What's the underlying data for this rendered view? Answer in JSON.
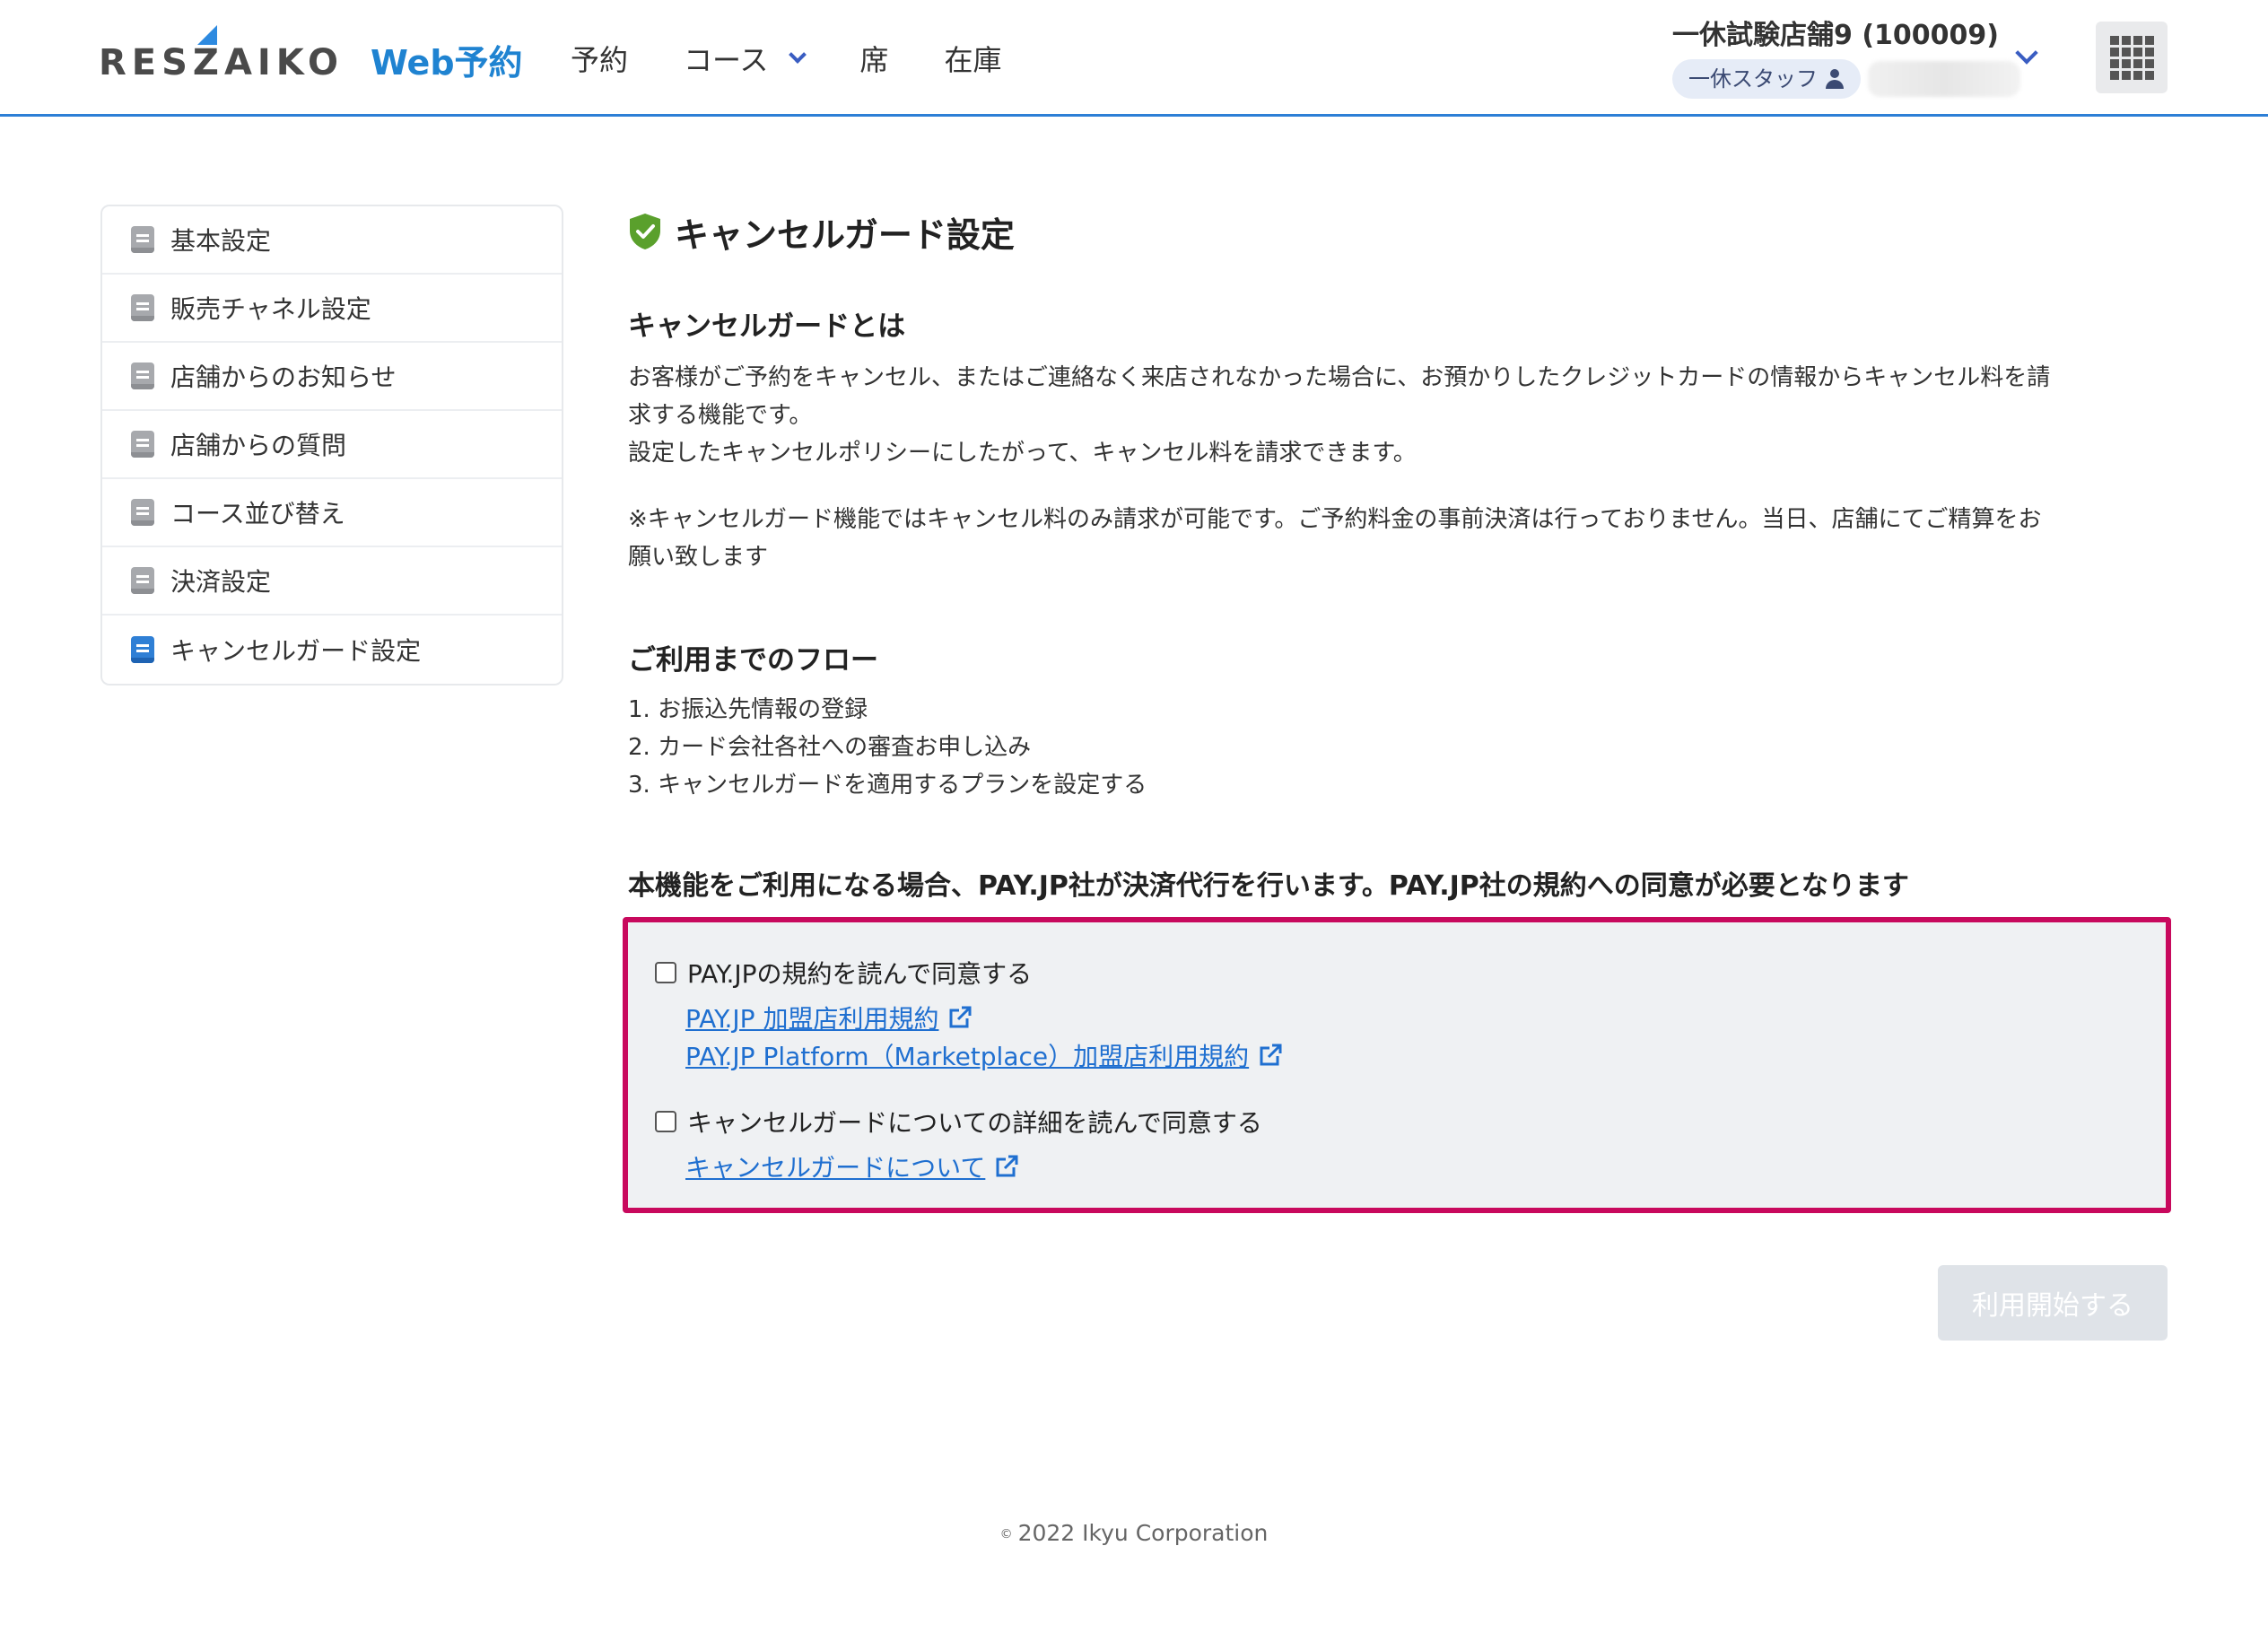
{
  "header": {
    "logo_text": "RESZAIKO",
    "logo_sub": "Web予約",
    "nav": [
      {
        "label": "予約"
      },
      {
        "label": "コース"
      },
      {
        "label": "席"
      },
      {
        "label": "在庫"
      }
    ],
    "store_name": "一休試験店舗9 (100009)",
    "staff_label": "一休スタッフ"
  },
  "sidebar": {
    "items": [
      {
        "label": "基本設定",
        "active": false
      },
      {
        "label": "販売チャネル設定",
        "active": false
      },
      {
        "label": "店舗からのお知らせ",
        "active": false
      },
      {
        "label": "店舗からの質問",
        "active": false
      },
      {
        "label": "コース並び替え",
        "active": false
      },
      {
        "label": "決済設定",
        "active": false
      },
      {
        "label": "キャンセルガード設定",
        "active": true
      }
    ]
  },
  "main": {
    "title": "キャンセルガード設定",
    "about_title": "キャンセルガードとは",
    "about_line1": "お客様がご予約をキャンセル、またはご連絡なく来店されなかった場合に、お預かりしたクレジットカードの情報からキャンセル料を請",
    "about_line2": "求する機能です。",
    "about_line3": "設定したキャンセルポリシーにしたがって、キャンセル料を請求できます。",
    "note_line1": "※キャンセルガード機能ではキャンセル料のみ請求が可能です。ご予約料金の事前決済は行っておりません。当日、店舗にてご精算をお",
    "note_line2": "願い致します",
    "flow_title": "ご利用までのフロー",
    "flow_steps": [
      "1. お振込先情報の登録",
      "2. カード会社各社への審査お申し込み",
      "3. キャンセルガードを適用するプランを設定する"
    ],
    "payjp_notice": "本機能をご利用になる場合、PAY.JP社が決済代行を行います。PAY.JP社の規約への同意が必要となります"
  },
  "agreement": {
    "payjp_checkbox_label": "PAY.JPの規約を読んで同意する",
    "payjp_checked": false,
    "link_merchant_terms": "PAY.JP 加盟店利用規約",
    "link_platform_terms": "PAY.JP Platform（Marketplace）加盟店利用規約",
    "cancelguard_checkbox_label": "キャンセルガードについての詳細を読んで同意する",
    "cancelguard_checked": false,
    "link_cancelguard": "キャンセルガードについて"
  },
  "actions": {
    "start_label": "利用開始する",
    "start_enabled": false
  },
  "footer": {
    "copyright": "2022 Ikyu Corporation"
  },
  "colors": {
    "accent": "#2d7fd6",
    "highlight_border": "#c8095d",
    "link": "#1f6fd0",
    "shield_green": "#5aa02c"
  }
}
